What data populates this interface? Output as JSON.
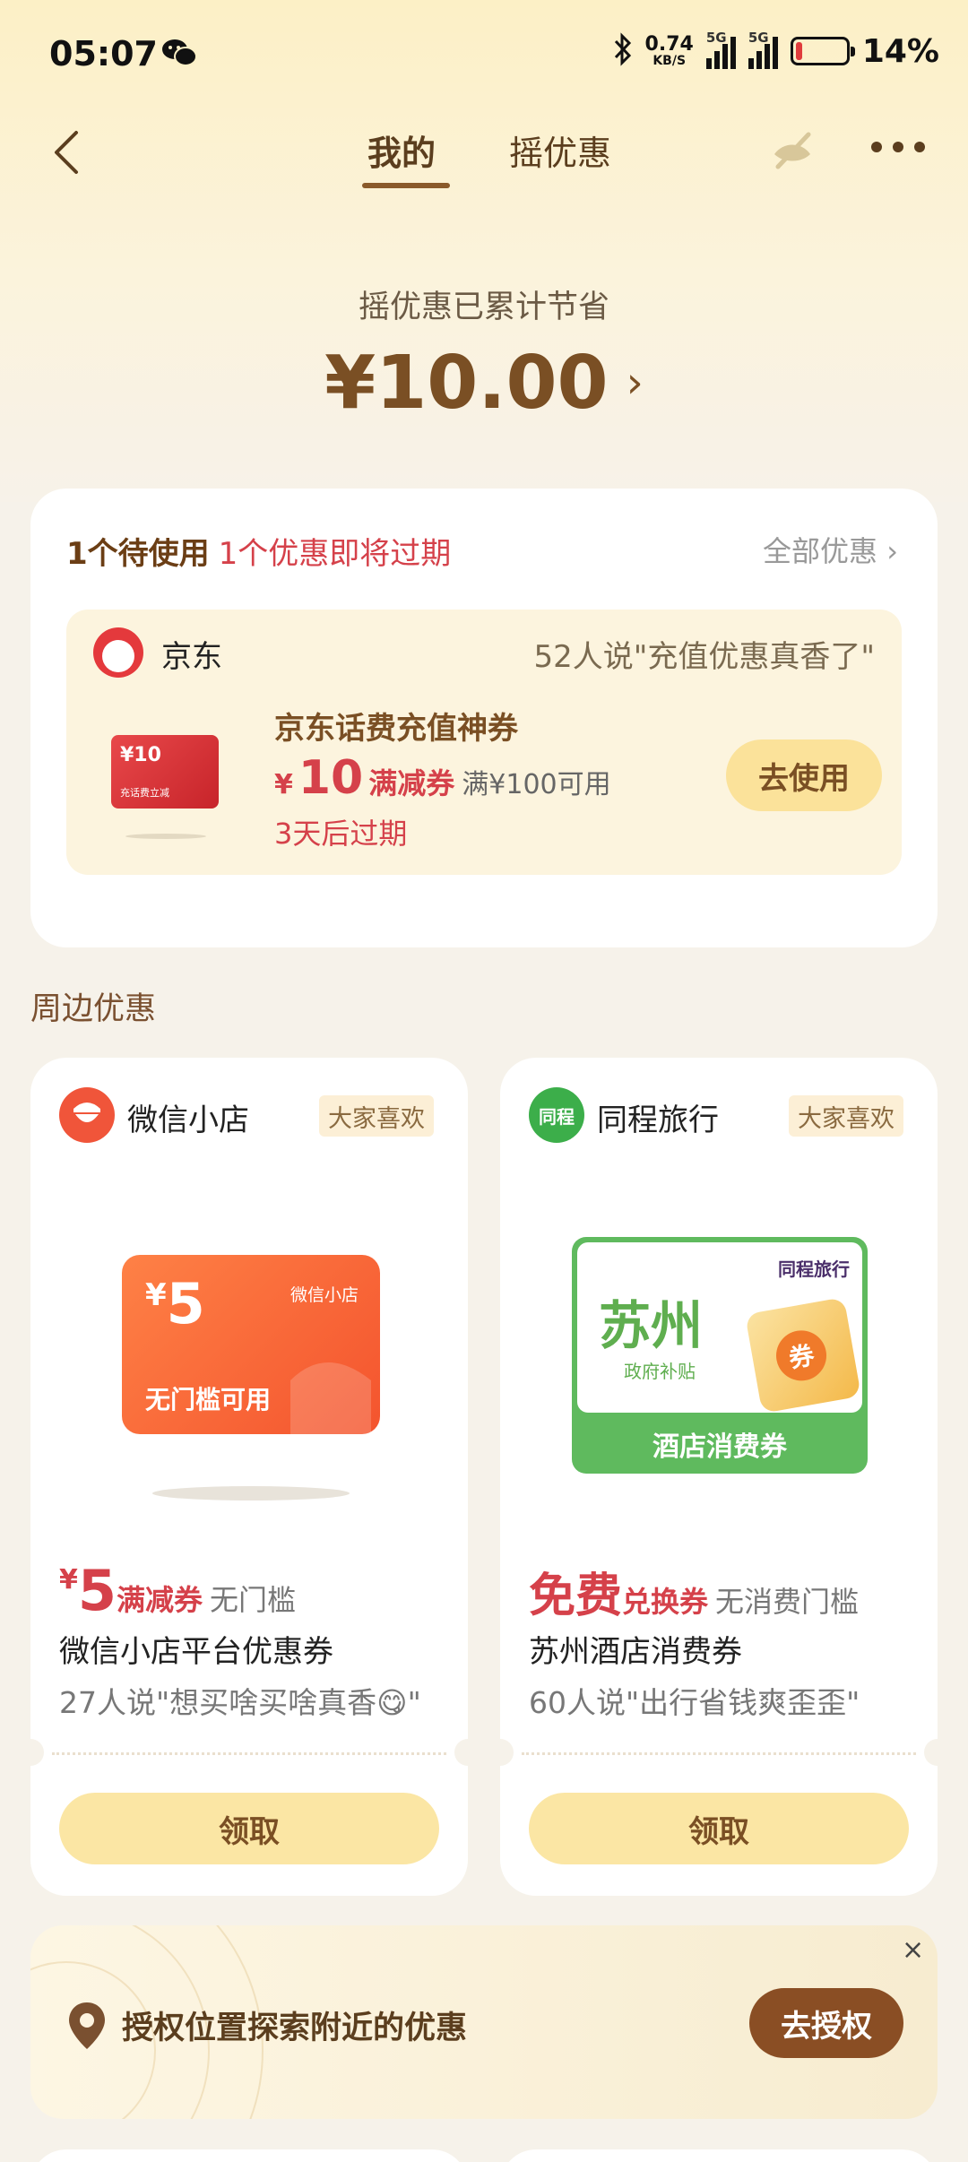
{
  "status_bar": {
    "time": "05:07",
    "net_speed_value": "0.74",
    "net_speed_unit": "KB/S",
    "sim1": "5G",
    "sim2": "5G",
    "battery": "14%",
    "battery_level": 0.14
  },
  "nav": {
    "tabs": [
      "我的",
      "摇优惠"
    ],
    "active_tab": "我的"
  },
  "summary": {
    "label": "摇优惠已累计节省",
    "amount": "¥10.00",
    "chevron": "›"
  },
  "pending": {
    "count_text": "1个待使用",
    "expiring_text": "1个优惠即将过期",
    "all_link": "全部优惠 ›"
  },
  "jd": {
    "brand": "京东",
    "social": "52人说\"充值优惠真香了\"",
    "title": "京东话费充值神券",
    "price_symbol": "¥",
    "price": "10",
    "kind": "满减券",
    "condition": "满¥100可用",
    "expiry": "3天后过期",
    "button": "去使用",
    "img_amount": "¥10",
    "img_text": "充话费立减"
  },
  "nearby": {
    "title": "周边优惠"
  },
  "cards": [
    {
      "brand": "微信小店",
      "badge": "大家喜欢",
      "coupon_amount": "5",
      "coupon_brand": "微信小店",
      "coupon_text": "无门槛可用",
      "price_symbol": "¥",
      "price": "5",
      "kind": "满减券",
      "condition": "无门槛",
      "title": "微信小店平台优惠券",
      "quote": "27人说\"想买啥买啥真香😋\"",
      "button": "领取"
    },
    {
      "brand": "同程旅行",
      "badge": "大家喜欢",
      "logo_text": "同程",
      "coupon_city": "苏州",
      "coupon_sub": "政府补贴",
      "coupon_brand": "同程旅行",
      "coupon_bottom": "酒店消费券",
      "ticket_char": "券",
      "price_symbol": "",
      "price": "免费",
      "kind": "兑换券",
      "condition": "无消费门槛",
      "title": "苏州酒店消费券",
      "quote": "60人说\"出行省钱爽歪歪\"",
      "button": "领取"
    }
  ],
  "location": {
    "text": "授权位置探索附近的优惠",
    "button": "去授权",
    "close": "×"
  },
  "colors": {
    "accent_brown": "#7a4f24",
    "red": "#d5414a",
    "button_yellow": "#fbe29a",
    "jd_red": "#e4393c",
    "wx_orange": "#f4542e",
    "tc_green": "#5fba5e"
  }
}
